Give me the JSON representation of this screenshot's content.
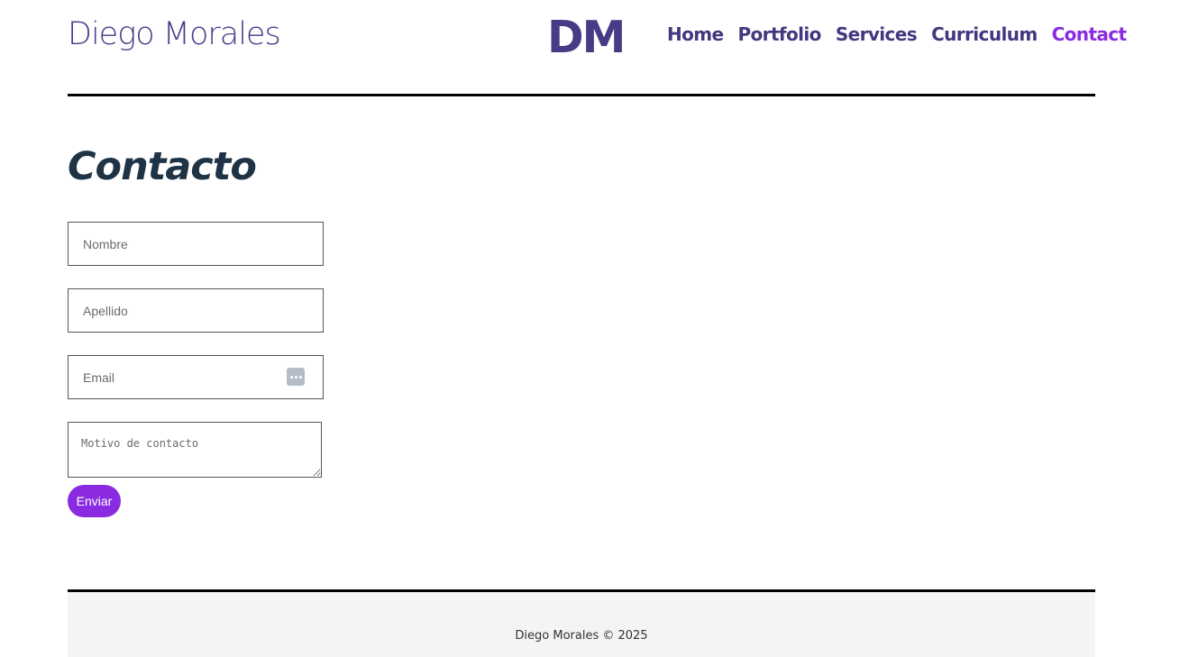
{
  "header": {
    "site_name": "Diego Morales",
    "logo": "DM",
    "nav": [
      {
        "label": "Home"
      },
      {
        "label": "Portfolio"
      },
      {
        "label": "Services"
      },
      {
        "label": "Curriculum"
      },
      {
        "label": "Contact",
        "active": true
      }
    ]
  },
  "main": {
    "title": "Contacto",
    "form": {
      "nombre_placeholder": "Nombre",
      "apellido_placeholder": "Apellido",
      "email_placeholder": "Email",
      "motivo_placeholder": "Motivo de contacto",
      "submit_label": "Enviar",
      "email_autofill_icon": "password-manager-icon"
    }
  },
  "footer": {
    "text": "Diego Morales © 2025"
  },
  "colors": {
    "accent": "#8a2be2",
    "nav": "#45377f",
    "heading": "#1f3346",
    "footer_bg": "#f4f4f4"
  }
}
